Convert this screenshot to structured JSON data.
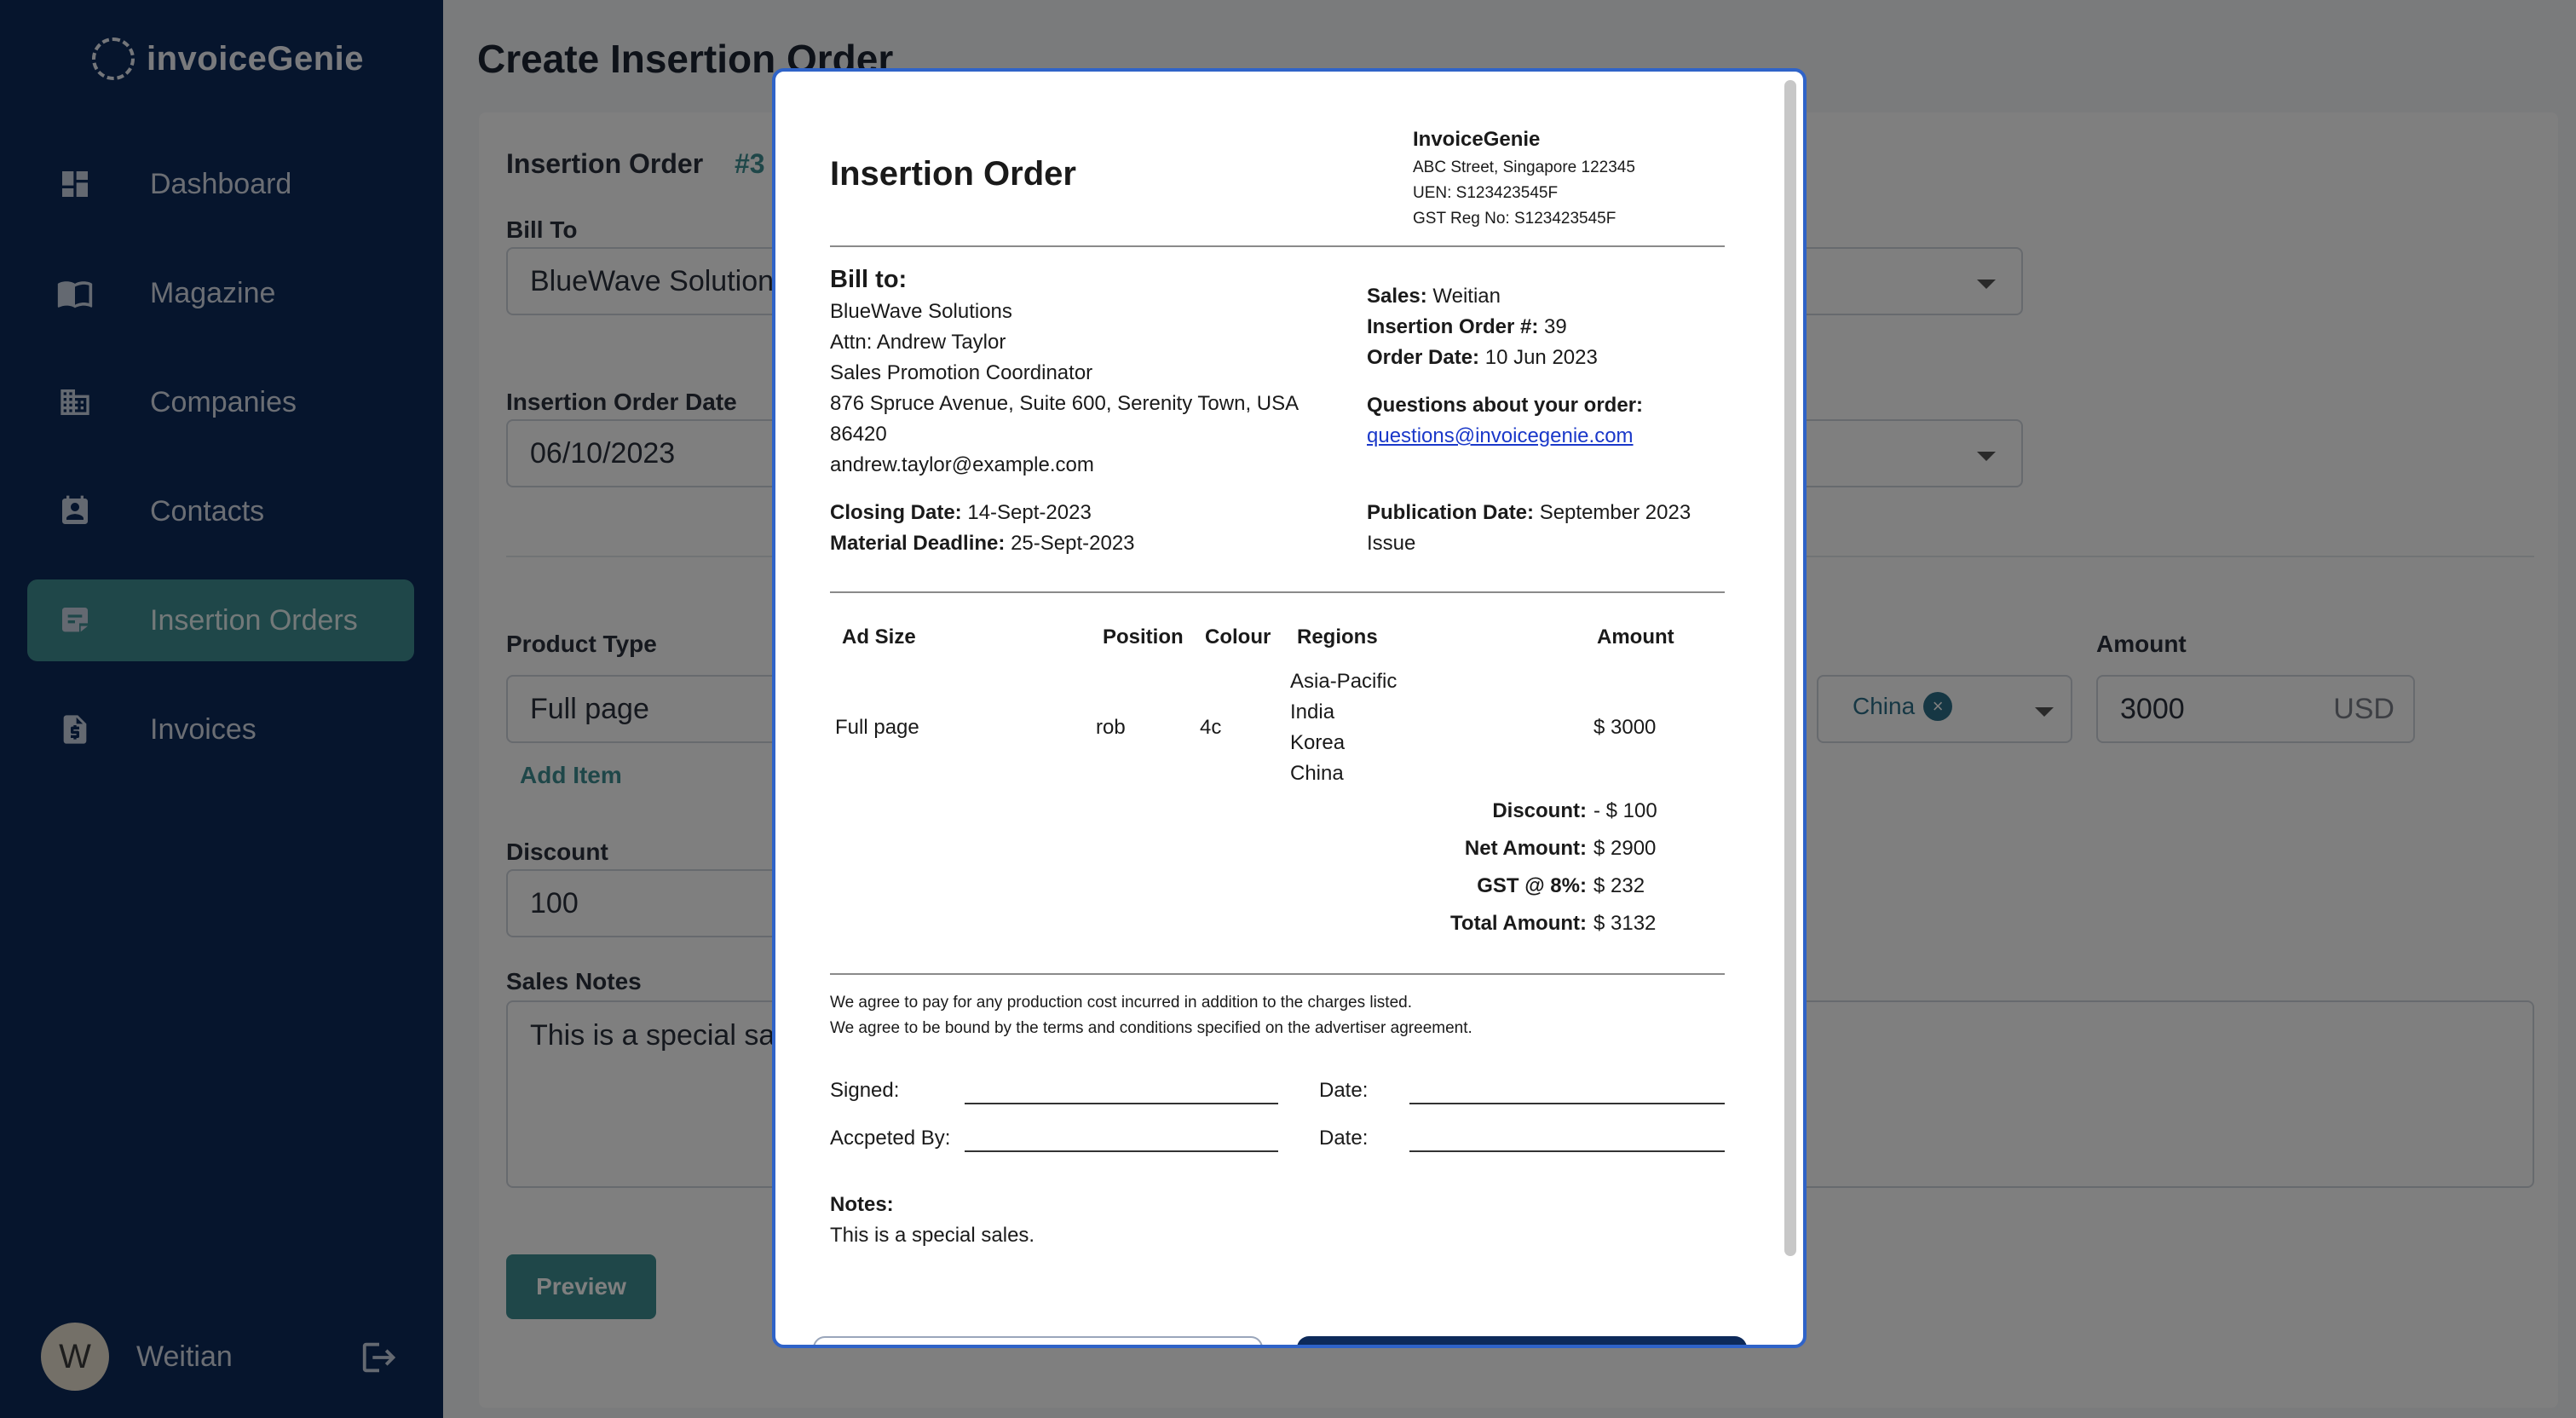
{
  "app": {
    "brand": "invoiceGenie"
  },
  "sidebar": {
    "items": [
      {
        "label": "Dashboard",
        "icon": "dashboard-icon"
      },
      {
        "label": "Magazine",
        "icon": "book-open-icon"
      },
      {
        "label": "Companies",
        "icon": "building-icon"
      },
      {
        "label": "Contacts",
        "icon": "contact-card-icon"
      },
      {
        "label": "Insertion Orders",
        "icon": "note-icon",
        "active": true
      },
      {
        "label": "Invoices",
        "icon": "invoice-dollar-icon"
      }
    ],
    "user": {
      "initial": "W",
      "name": "Weitian"
    }
  },
  "main": {
    "title": "Create Insertion Order",
    "form": {
      "section_title": "Insertion Order",
      "order_number_fragment": "#3",
      "bill_to_label": "Bill To",
      "bill_to_value": "BlueWave Solution",
      "date_label": "Insertion Order Date",
      "date_value": "06/10/2023",
      "product_type_label": "Product Type",
      "product_type_value": "Full page",
      "add_item": "Add Item",
      "amount_label": "Amount",
      "amount_value": "3000",
      "amount_currency": "USD",
      "region_chip": "China",
      "discount_label": "Discount",
      "discount_value": "100",
      "sales_notes_label": "Sales Notes",
      "sales_notes_value": "This is a special sa",
      "preview_button": "Preview"
    }
  },
  "modal": {
    "title": "Insertion Order",
    "company": {
      "name": "InvoiceGenie",
      "address": "ABC Street, Singapore 122345",
      "uen": "UEN: S123423545F",
      "gst": "GST Reg No: S123423545F"
    },
    "bill_to": {
      "heading": "Bill to:",
      "lines": [
        "BlueWave Solutions",
        "Attn: Andrew Taylor",
        "Sales Promotion Coordinator",
        "876 Spruce Avenue, Suite 600, Serenity Town, USA",
        "86420",
        "andrew.taylor@example.com"
      ]
    },
    "meta": {
      "sales_label": "Sales:",
      "sales_value": "Weitian",
      "io_label": "Insertion Order #:",
      "io_value": "39",
      "order_date_label": "Order Date:",
      "order_date_value": "10 Jun 2023",
      "questions_label": "Questions about your order:",
      "questions_email": "questions@invoicegenie.com"
    },
    "dates": {
      "closing_label": "Closing Date:",
      "closing_value": "14-Sept-2023",
      "material_label": "Material Deadline:",
      "material_value": "25-Sept-2023",
      "publication_label": "Publication Date:",
      "publication_value_1": "September 2023",
      "publication_value_2": "Issue"
    },
    "table": {
      "headers": [
        "Ad Size",
        "Position",
        "Colour",
        "Regions",
        "Amount"
      ],
      "row": {
        "ad_size": "Full page",
        "position": "rob",
        "colour": "4c",
        "regions": [
          "Asia-Pacific",
          "India",
          "Korea",
          "China"
        ],
        "amount": "$ 3000"
      }
    },
    "totals": [
      {
        "label": "Discount:",
        "value": "- $ 100"
      },
      {
        "label": "Net Amount:",
        "value": "$ 2900"
      },
      {
        "label": "GST @ 8%:",
        "value": "$ 232"
      },
      {
        "label": "Total Amount:",
        "value": "$ 3132"
      }
    ],
    "terms": [
      "We agree to pay for any production cost incurred in addition to the charges listed.",
      "We agree to be bound by the terms and conditions specified on the advertiser agreement."
    ],
    "signatures": {
      "signed": "Signed:",
      "accepted": "Accpeted By:",
      "date": "Date:"
    },
    "notes": {
      "label": "Notes:",
      "value": "This is a special sales."
    }
  }
}
